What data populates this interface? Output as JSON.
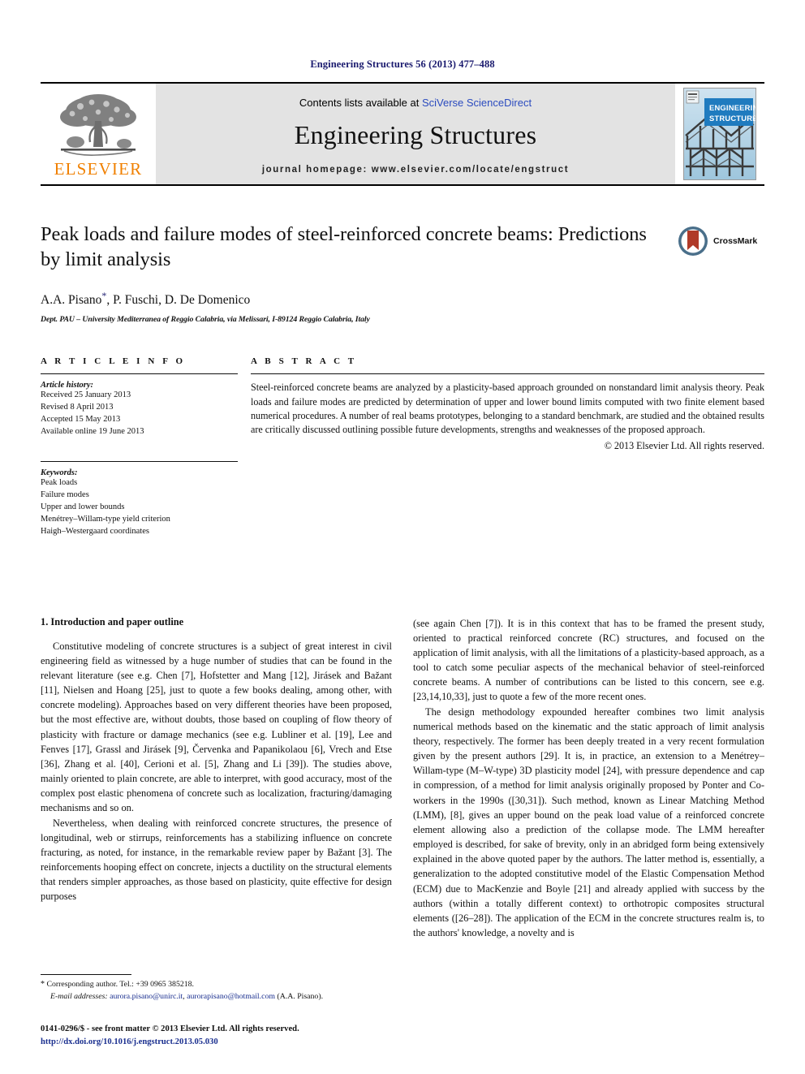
{
  "running_head": "Engineering Structures 56 (2013) 477–488",
  "masthead": {
    "publisher_name": "ELSEVIER",
    "contents_prefix": "Contents lists available at ",
    "contents_link": "SciVerse ScienceDirect",
    "journal_title": "Engineering Structures",
    "homepage": "journal homepage: www.elsevier.com/locate/engstruct",
    "cover_line1": "ENGINEERING",
    "cover_line2": "STRUCTURES"
  },
  "title_block": {
    "title": "Peak loads and failure modes of steel-reinforced concrete beams: Predictions by limit analysis",
    "authors": "A.A. Pisano",
    "authors_rest": ", P. Fuschi, D. De Domenico",
    "corresponding_marker": "*",
    "affiliation": "Dept. PAU – University Mediterranea of Reggio Calabria, via Melissari, I-89124 Reggio Calabria, Italy",
    "crossmark_label": "CrossMark"
  },
  "article_info": {
    "heading": "A R T I C L E   I N F O",
    "history_label": "Article history:",
    "history": [
      "Received 25 January 2013",
      "Revised 8 April 2013",
      "Accepted 15 May 2013",
      "Available online 19 June 2013"
    ],
    "keywords_label": "Keywords:",
    "keywords": [
      "Peak loads",
      "Failure modes",
      "Upper and lower bounds",
      "Menétrey–Willam-type yield criterion",
      "Haigh–Westergaard coordinates"
    ]
  },
  "abstract": {
    "heading": "A B S T R A C T",
    "text": "Steel-reinforced concrete beams are analyzed by a plasticity-based approach grounded on nonstandard limit analysis theory. Peak loads and failure modes are predicted by determination of upper and lower bound limits computed with two finite element based numerical procedures. A number of real beams prototypes, belonging to a standard benchmark, are studied and the obtained results are critically discussed outlining possible future developments, strengths and weaknesses of the proposed approach.",
    "copyright": "© 2013 Elsevier Ltd. All rights reserved."
  },
  "body": {
    "section_title": "1. Introduction and paper outline",
    "left_paragraphs": [
      "Constitutive modeling of concrete structures is a subject of great interest in civil engineering field as witnessed by a huge number of studies that can be found in the relevant literature (see e.g. Chen [7], Hofstetter and Mang [12], Jirásek and Bažant [11], Nielsen and Hoang [25], just to quote a few books dealing, among other, with concrete modeling). Approaches based on very different theories have been proposed, but the most effective are, without doubts, those based on coupling of flow theory of plasticity with fracture or damage mechanics (see e.g. Lubliner et al. [19], Lee and Fenves [17], Grassl and Jirásek [9], Červenka and Papanikolaou [6], Vrech and Etse [36], Zhang et al. [40], Cerioni et al. [5], Zhang and Li [39]). The studies above, mainly oriented to plain concrete, are able to interpret, with good accuracy, most of the complex post elastic phenomena of concrete such as localization, fracturing/damaging mechanisms and so on.",
      "Nevertheless, when dealing with reinforced concrete structures, the presence of longitudinal, web or stirrups, reinforcements has a stabilizing influence on concrete fracturing, as noted, for instance, in the remarkable review paper by Bažant [3]. The reinforcements hooping effect on concrete, injects a ductility on the structural elements that renders simpler approaches, as those based on plasticity, quite effective for design purposes"
    ],
    "right_paragraphs": [
      "(see again Chen [7]). It is in this context that has to be framed the present study, oriented to practical reinforced concrete (RC) structures, and focused on the application of limit analysis, with all the limitations of a plasticity-based approach, as a tool to catch some peculiar aspects of the mechanical behavior of steel-reinforced concrete beams. A number of contributions can be listed to this concern, see e.g. [23,14,10,33], just to quote a few of the more recent ones.",
      "The design methodology expounded hereafter combines two limit analysis numerical methods based on the kinematic and the static approach of limit analysis theory, respectively. The former has been deeply treated in a very recent formulation given by the present authors [29]. It is, in practice, an extension to a Menétrey–Willam-type (M–W-type) 3D plasticity model [24], with pressure dependence and cap in compression, of a method for limit analysis originally proposed by Ponter and Co-workers in the 1990s ([30,31]). Such method, known as Linear Matching Method (LMM), [8], gives an upper bound on the peak load value of a reinforced concrete element allowing also a prediction of the collapse mode. The LMM hereafter employed is described, for sake of brevity, only in an abridged form being extensively explained in the above quoted paper by the authors. The latter method is, essentially, a generalization to the adopted constitutive model of the Elastic Compensation Method (ECM) due to MacKenzie and Boyle [21] and already applied with success by the authors (within a totally different context) to orthotropic composites structural elements ([26–28]). The application of the ECM in the concrete structures realm is, to the authors' knowledge, a novelty and is"
    ]
  },
  "footnote": {
    "marker": "*",
    "corresponding": "Corresponding author. Tel.: +39 0965 385218.",
    "email_label": "E-mail addresses:",
    "email1": "aurora.pisano@unirc.it",
    "email2": "aurorapisano@hotmail.com",
    "email_suffix": " (A.A. Pisano)."
  },
  "footer": {
    "issn_line": "0141-0296/$ - see front matter © 2013 Elsevier Ltd. All rights reserved.",
    "doi": "http://dx.doi.org/10.1016/j.engstruct.2013.05.030"
  },
  "colors": {
    "link_blue": "#2b4bbf",
    "ref_blue": "#1a2f8f",
    "head_navy": "#1a1a6e",
    "elsevier_orange": "#F08000",
    "masthead_gray": "#e3e3e3",
    "cover_blue": "#1f7bbf"
  }
}
